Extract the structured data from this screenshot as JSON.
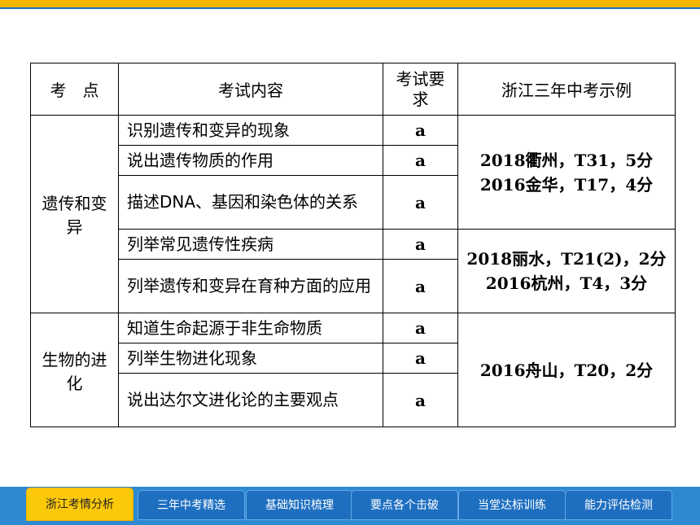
{
  "header": {
    "kaodian": "考　点",
    "content": "考试内容",
    "requirement": "考试要求",
    "example": "浙江三年中考示例"
  },
  "sections": [
    {
      "topic": "遗传和变异",
      "items": [
        {
          "content": "识别遗传和变异的现象",
          "req": "a"
        },
        {
          "content": "说出遗传物质的作用",
          "req": "a"
        },
        {
          "content": "描述DNA、基因和染色体的关系",
          "req": "a"
        },
        {
          "content": "列举常见遗传性疾病",
          "req": "a"
        },
        {
          "content": "列举遗传和变异在育种方面的应用",
          "req": "a"
        }
      ],
      "examples": [
        [
          "2018衢州，T31，5分",
          "2016金华，T17，4分"
        ],
        [
          "2018丽水，T21(2)，2分",
          "2016杭州，T4，3分"
        ]
      ]
    },
    {
      "topic": "生物的进化",
      "items": [
        {
          "content": "知道生命起源于非生命物质",
          "req": "a"
        },
        {
          "content": "列举生物进化现象",
          "req": "a"
        },
        {
          "content": "说出达尔文进化论的主要观点",
          "req": "a"
        }
      ],
      "examples": [
        [
          "2016舟山，T20，2分"
        ]
      ]
    }
  ],
  "tabs": [
    "浙江考情分析",
    "三年中考精选",
    "基础知识梳理",
    "要点各个击破",
    "当堂达标训练",
    "能力评估检测"
  ],
  "colors": {
    "accent": "#f5b800",
    "nav": "#1e6fc0",
    "active_tab": "#fbc80a"
  }
}
